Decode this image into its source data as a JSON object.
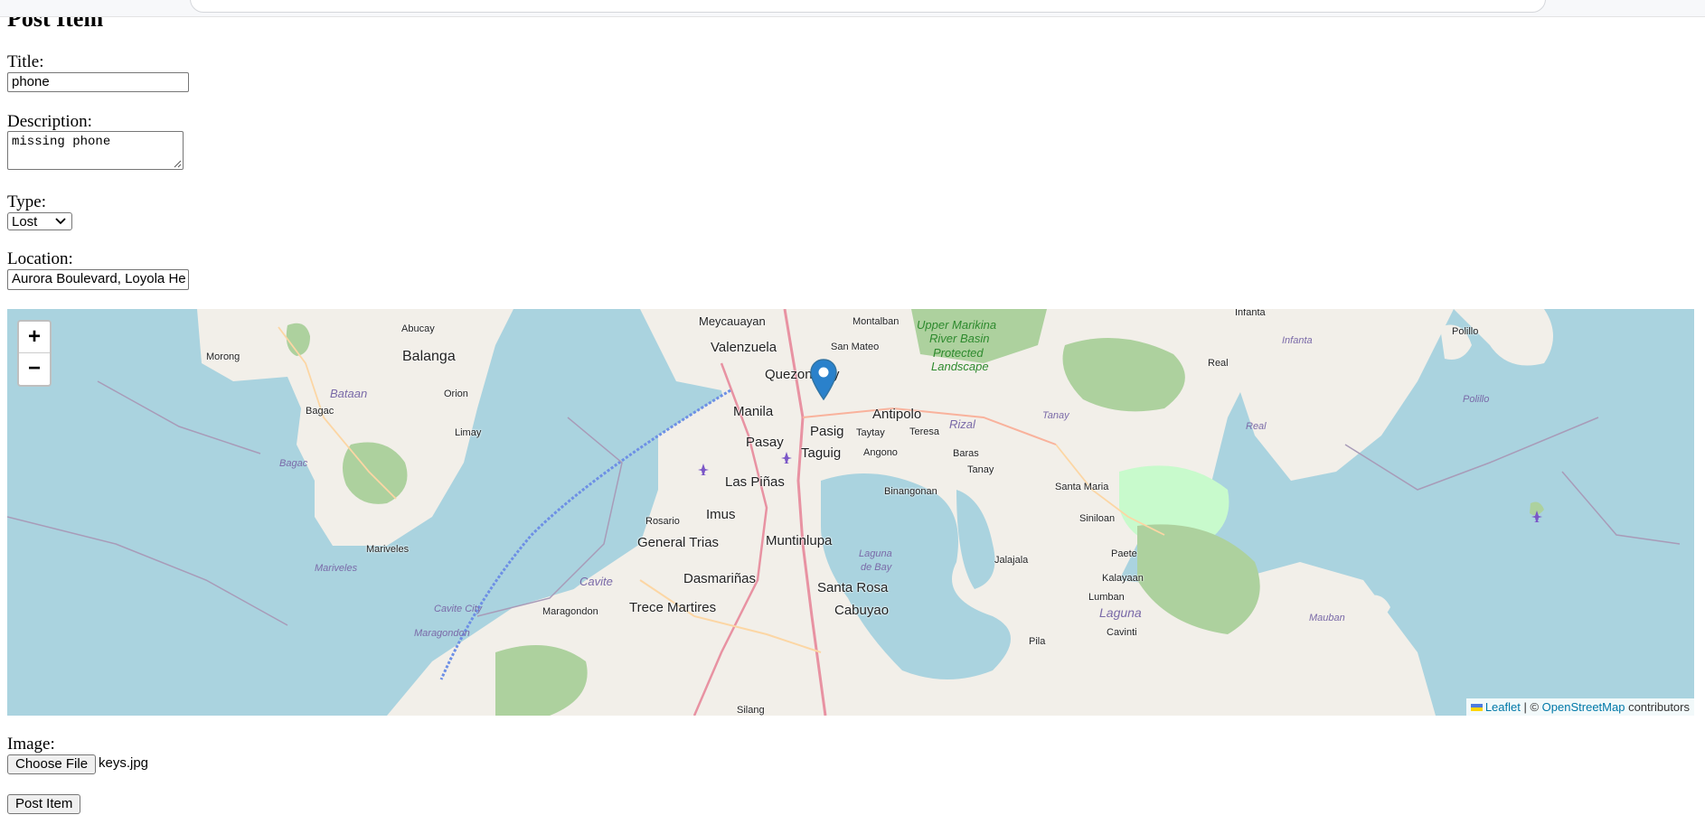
{
  "page": {
    "title": "Post Item"
  },
  "form": {
    "title_label": "Title:",
    "title_value": "phone",
    "description_label": "Description:",
    "description_value": "missing phone",
    "type_label": "Type:",
    "type_value": "Lost",
    "location_label": "Location:",
    "location_value": "Aurora Boulevard, Loyola He",
    "image_label": "Image:",
    "choose_file_label": "Choose File",
    "file_name": "keys.jpg",
    "submit_label": "Post Item"
  },
  "map": {
    "zoom_in": "+",
    "zoom_out": "−",
    "attribution": {
      "leaflet": "Leaflet",
      "separator": " | © ",
      "osm": "OpenStreetMap",
      "suffix": " contributors"
    },
    "places": {
      "meycauayan": "Meycauayan",
      "abucay": "Abucay",
      "montalban": "Montalban",
      "upper_marikina": "Upper Marikina",
      "river_basin": "River Basin",
      "protected": "Protected",
      "landscape": "Landscape",
      "infanta": "Infanta",
      "infanta_sea": "Infanta",
      "polillo": "Polillo",
      "polillo_sea": "Polillo",
      "morong": "Morong",
      "balanga": "Balanga",
      "valenzuela": "Valenzuela",
      "san_mateo": "San Mateo",
      "quezon_city": "Quezon City",
      "real": "Real",
      "real_sea": "Real",
      "bataan": "Bataan",
      "orion": "Orion",
      "bagac": "Bagac",
      "limay": "Limay",
      "manila": "Manila",
      "antipolo": "Antipolo",
      "rizal": "Rizal",
      "tanay_sea": "Tanay",
      "bagac_sea": "Bagac",
      "pasig": "Pasig",
      "taytay": "Taytay",
      "teresa": "Teresa",
      "pasay": "Pasay",
      "taguig": "Taguig",
      "angono": "Angono",
      "baras": "Baras",
      "tanay": "Tanay",
      "las_pinas": "Las Piñas",
      "binangonan": "Binangonan",
      "santa_maria": "Santa Maria",
      "mariveles": "Mariveles",
      "mariveles_sea": "Mariveles",
      "imus": "Imus",
      "rosario": "Rosario",
      "siniloan": "Siniloan",
      "general_trias": "General Trias",
      "muntinlupa": "Muntinlupa",
      "laguna_de_bay_1": "Laguna",
      "laguna_de_bay_2": "de Bay",
      "cavite_city": "Cavite City",
      "paete": "Paete",
      "jalajala": "Jalajala",
      "cavite": "Cavite",
      "dasmarinas": "Dasmariñas",
      "kalayaan": "Kalayaan",
      "santa_rosa": "Santa Rosa",
      "maragondon": "Maragondon",
      "trece_martires": "Trece Martires",
      "cabuyao": "Cabuyao",
      "lumban": "Lumban",
      "laguna": "Laguna",
      "mauban": "Mauban",
      "cavinti": "Cavinti",
      "pila": "Pila",
      "maragondon_sea": "Maragondon",
      "silang": "Silang"
    }
  }
}
